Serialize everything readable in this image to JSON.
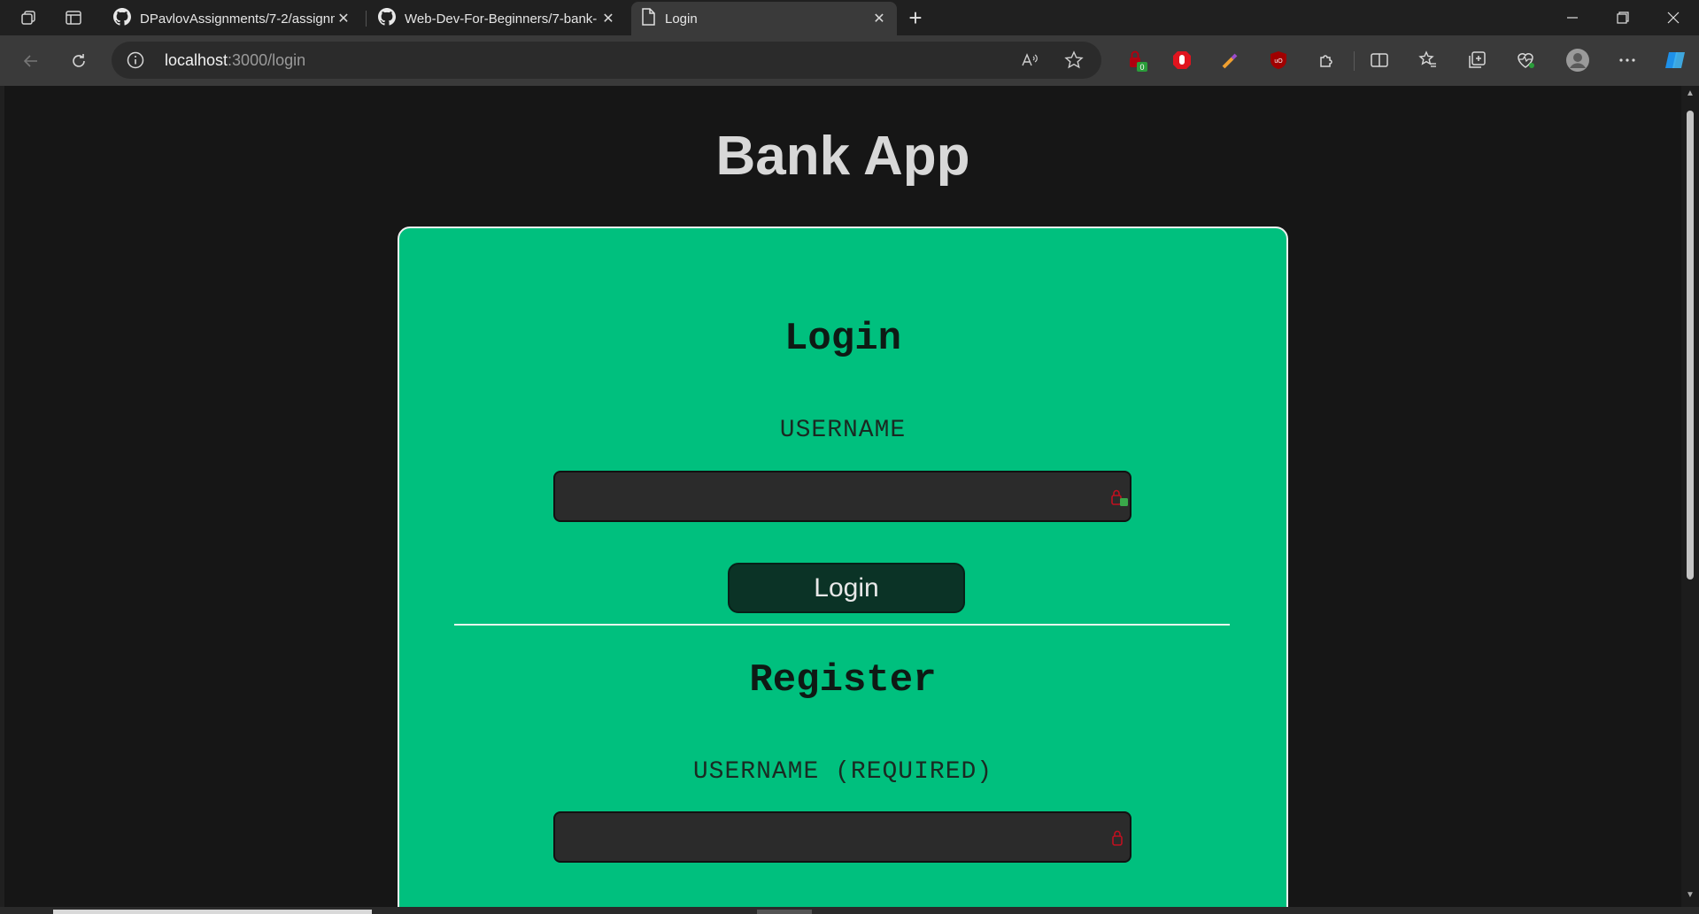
{
  "browser": {
    "tabs": [
      {
        "title": "DPavlovAssignments/7-2/assignm",
        "icon": "github-icon",
        "active": false
      },
      {
        "title": "Web-Dev-For-Beginners/7-bank-",
        "icon": "github-icon",
        "active": false
      },
      {
        "title": "Login",
        "icon": "page-icon",
        "active": true
      }
    ],
    "address": {
      "host": "localhost",
      "path": ":3000/login"
    },
    "extension_badge": "0"
  },
  "page": {
    "app_title": "Bank App",
    "login": {
      "title": "Login",
      "username_label": "USERNAME",
      "username_value": "",
      "submit_label": "Login"
    },
    "register": {
      "title": "Register",
      "username_label": "USERNAME (REQUIRED)",
      "username_value": ""
    }
  },
  "colors": {
    "card_bg": "#00c07e",
    "button_bg": "#0b3326",
    "input_bg": "#2b2b2b",
    "page_bg": "#161616"
  }
}
